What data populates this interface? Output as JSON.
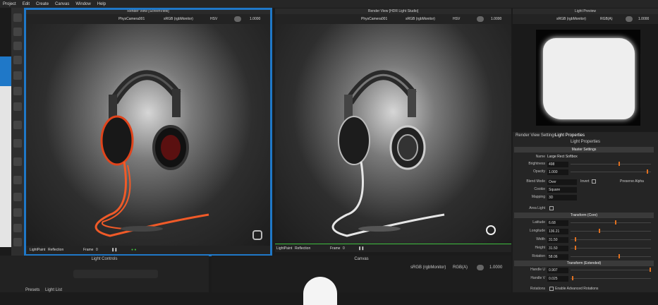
{
  "menu": [
    "Project",
    "Edit",
    "Create",
    "Canvas",
    "Window",
    "Help"
  ],
  "left_view": {
    "title": "Render View [ScreenView]",
    "camera": "PhysCamera001",
    "colorspace": "sRGB (rgbMonitor)",
    "mode": "HSV",
    "exposure": "1.0000",
    "paint_mode": "LightPaint",
    "reflection": "Reflection",
    "frame_label": "Frame",
    "frame": "0"
  },
  "mid_view": {
    "title": "Render View [HDR Light Studio]",
    "camera": "PhysCamera001",
    "colorspace": "sRGB (rgbMonitor)",
    "mode": "HSV",
    "exposure": "1.0000",
    "paint_mode": "LightPaint",
    "reflection": "Reflection",
    "frame_label": "Frame",
    "frame": "0"
  },
  "preview": {
    "title": "Light Preview",
    "colorspace": "sRGB (rgbMonitor)",
    "mode": "RGB(A)",
    "exposure": "1.0000"
  },
  "props": {
    "tab1": "Render View Settings",
    "tab2": "Light Properties",
    "header": "Light Properties",
    "master": "Master Settings",
    "name_label": "Name",
    "name": "Large Rect Softbox",
    "rows": [
      {
        "label": "Brightness",
        "value": "498",
        "pos": 0.6
      },
      {
        "label": "Opacity",
        "value": "1.000",
        "pos": 0.95
      }
    ],
    "blend_label": "Blend Mode",
    "blend": "Over",
    "invert": "Invert",
    "preserve_alpha": "Preserve Alpha",
    "cookie_label": "Cookie",
    "cookie": "Square",
    "mapping_label": "Mapping",
    "mapping": "3D",
    "area_light": "Area Light",
    "transform_core": "Transform (Core)",
    "core_rows": [
      {
        "label": "Latitude",
        "value": "6.68",
        "pos": 0.55
      },
      {
        "label": "Longitude",
        "value": "136.21",
        "pos": 0.35
      },
      {
        "label": "Width",
        "value": "31.50",
        "pos": 0.05
      },
      {
        "label": "Height",
        "value": "31.50",
        "pos": 0.05
      },
      {
        "label": "Rotation",
        "value": "58.06",
        "pos": 0.6
      }
    ],
    "transform_ext": "Transform (Extended)",
    "ext_rows": [
      {
        "label": "Handle U",
        "value": "0.907",
        "pos": 0.98
      },
      {
        "label": "Handle V",
        "value": "0.025",
        "pos": 0.02
      }
    ],
    "rotations": "Rotations",
    "enable_adv": "Enable Advanced Rotations"
  },
  "light_controls": {
    "title": "Light Controls",
    "tab1": "Presets",
    "tab2": "Light List"
  },
  "canvas": {
    "title": "Canvas",
    "colorspace": "sRGB (rgbMonitor)",
    "mode": "RGB(A)",
    "exposure": "1.0000"
  }
}
